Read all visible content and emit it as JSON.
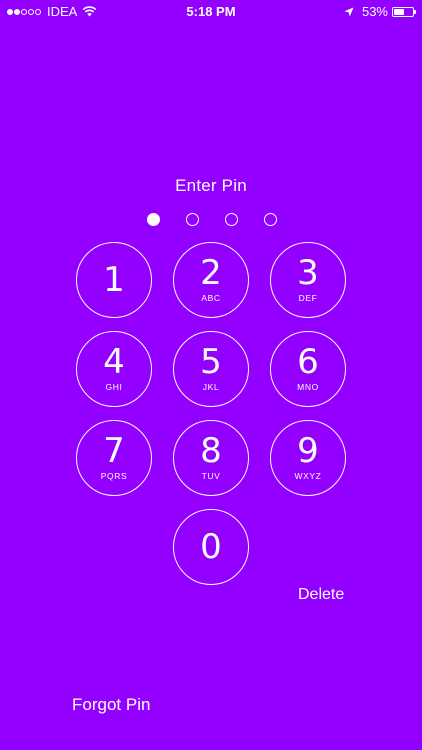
{
  "status_bar": {
    "carrier": "IDEA",
    "time": "5:18 PM",
    "battery_percent": "53%",
    "battery_level": 0.53,
    "signal_bars_filled": 2,
    "signal_bars_total": 5,
    "icons": [
      "signal-dots-icon",
      "wifi-icon",
      "location-arrow-icon",
      "battery-icon"
    ]
  },
  "title": "Enter Pin",
  "pin": {
    "length": 4,
    "entered": 1
  },
  "keypad": {
    "keys": [
      {
        "digit": "1",
        "letters": ""
      },
      {
        "digit": "2",
        "letters": "ABC"
      },
      {
        "digit": "3",
        "letters": "DEF"
      },
      {
        "digit": "4",
        "letters": "GHI"
      },
      {
        "digit": "5",
        "letters": "JKL"
      },
      {
        "digit": "6",
        "letters": "MNO"
      },
      {
        "digit": "7",
        "letters": "PQRS"
      },
      {
        "digit": "8",
        "letters": "TUV"
      },
      {
        "digit": "9",
        "letters": "WXYZ"
      },
      {
        "digit": "0",
        "letters": ""
      }
    ]
  },
  "delete_label": "Delete",
  "forgot_label": "Forgot Pin",
  "colors": {
    "background": "#9400FF",
    "foreground": "#FFFFFF"
  }
}
